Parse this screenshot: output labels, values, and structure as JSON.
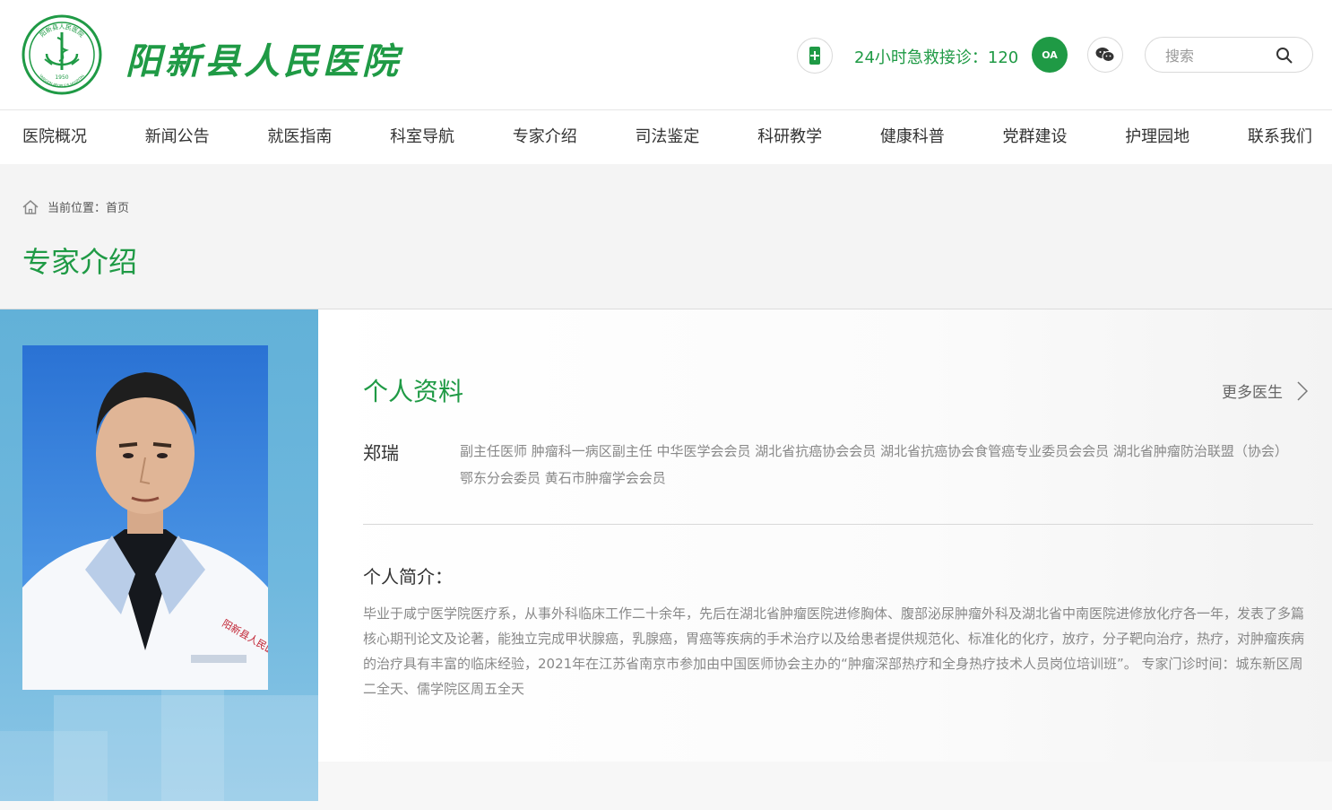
{
  "header": {
    "hospital_name": "阳新县人民医院",
    "emblem_text_top": "阳新县人民医院",
    "emblem_text_bottom": "YANGXIN PEOPLE'S HOSPITAL",
    "emblem_year": "1950",
    "hotline": "24小时急救接诊：120",
    "oa_label": "OA",
    "search_placeholder": "搜索"
  },
  "nav": [
    {
      "label": "医院概况"
    },
    {
      "label": "新闻公告"
    },
    {
      "label": "就医指南"
    },
    {
      "label": "科室导航"
    },
    {
      "label": "专家介绍"
    },
    {
      "label": "司法鉴定"
    },
    {
      "label": "科研教学"
    },
    {
      "label": "健康科普"
    },
    {
      "label": "党群建设"
    },
    {
      "label": "护理园地"
    },
    {
      "label": "联系我们"
    }
  ],
  "breadcrumb": {
    "text": "当前位置：首页"
  },
  "page_title": "专家介绍",
  "profile": {
    "section_title": "个人资料",
    "more_label": "更多医生",
    "name": "郑瑞",
    "titles": "副主任医师 肿瘤科一病区副主任 中华医学会会员 湖北省抗癌协会会员 湖北省抗癌协会食管癌专业委员会会员 湖北省肿瘤防治联盟（协会）鄂东分会委员 黄石市肿瘤学会会员",
    "intro_heading": "个人简介：",
    "intro_text": "毕业于咸宁医学院医疗系，从事外科临床工作二十余年，先后在湖北省肿瘤医院进修胸体、腹部泌尿肿瘤外科及湖北省中南医院进修放化疗各一年，发表了多篇核心期刊论文及论著，能独立完成甲状腺癌，乳腺癌，胃癌等疾病的手术治疗以及给患者提供规范化、标准化的化疗，放疗，分子靶向治疗，热疗，对肿瘤疾病的治疗具有丰富的临床经验，2021年在江苏省南京市参加由中国医师协会主办的“肿瘤深部热疗和全身热疗技术人员岗位培训班”。 专家门诊时间：城东新区周二全天、儒学院区周五全天",
    "coat_text": "阳新县人民医院"
  },
  "colors": {
    "brand_green": "#1f9a45",
    "panel_blue": "#62b1d8"
  }
}
